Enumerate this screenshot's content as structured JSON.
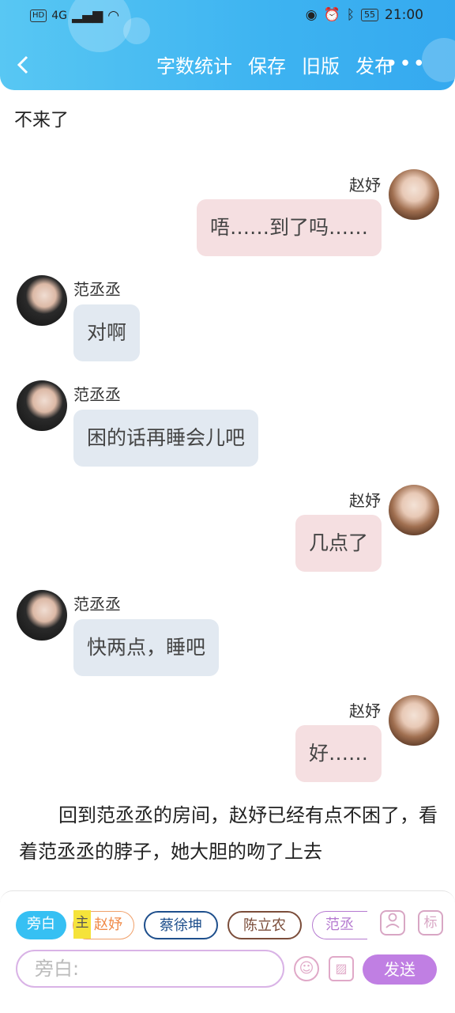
{
  "status_bar": {
    "hd": "HD",
    "network": "4G",
    "battery": "55",
    "time": "21:00"
  },
  "toolbar": {
    "back_icon": "back-arrow-icon",
    "items": [
      "字数统计",
      "保存",
      "旧版",
      "发布"
    ],
    "more": "•••"
  },
  "story": {
    "narration_top": "不来了",
    "narration_clipped": "──────────────────",
    "messages": [
      {
        "side": "right",
        "speaker": "赵妤",
        "text": "唔……到了吗……"
      },
      {
        "side": "left",
        "speaker": "范丞丞",
        "text": "对啊"
      },
      {
        "side": "left",
        "speaker": "范丞丞",
        "text": "困的话再睡会儿吧"
      },
      {
        "side": "right",
        "speaker": "赵妤",
        "text": "几点了"
      },
      {
        "side": "left",
        "speaker": "范丞丞",
        "text": "快两点，睡吧"
      },
      {
        "side": "right",
        "speaker": "赵妤",
        "text": "好……"
      }
    ],
    "narration_bottom": "回到范丞丞的房间，赵妤已经有点不困了，看着范丞丞的脖子，她大胆的吻了上去"
  },
  "composer": {
    "characters": [
      {
        "label": "旁白",
        "selected": true
      },
      {
        "label": "赵妤",
        "tag": "主"
      },
      {
        "label": "蔡徐坤"
      },
      {
        "label": "陈立农"
      },
      {
        "label": "范丞丞"
      }
    ],
    "role_icon": "user-icon",
    "mark_label": "标",
    "input_placeholder": "旁白:",
    "emoji_icon": "emoji-icon",
    "image_icon": "image-icon",
    "send_label": "发送"
  }
}
